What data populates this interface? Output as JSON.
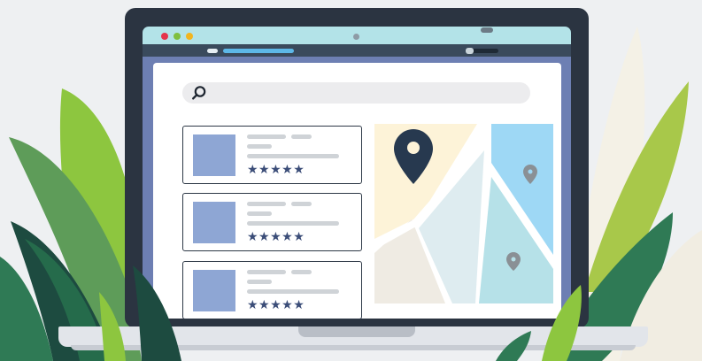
{
  "illustration": {
    "subject": "laptop showing a local search / map listing page",
    "window_dots": [
      {
        "name": "close",
        "color": "#e5344b"
      },
      {
        "name": "minimize",
        "color": "#f2b51f"
      },
      {
        "name": "maximize",
        "color": "#7fbf3f"
      }
    ],
    "colors": {
      "frame": "#2b3441",
      "browser_bar": "#b3e3e8",
      "content_bg": "#6d7fb3",
      "thumbnail": "#8ea6d4",
      "stars": "#3b4d78",
      "map_pin": "#27394f",
      "leaves": [
        "#2f7a55",
        "#8dc63f",
        "#1d4b40",
        "#a8c84a",
        "#5e9c59"
      ]
    }
  },
  "search": {
    "icon": "search-icon",
    "value": ""
  },
  "listings": [
    {
      "stars": "★★★★★",
      "rating": 5,
      "thumbnail": "image-placeholder"
    },
    {
      "stars": "★★★★★",
      "rating": 5,
      "thumbnail": "image-placeholder"
    },
    {
      "stars": "★★★★★",
      "rating": 5,
      "thumbnail": "image-placeholder"
    }
  ],
  "map": {
    "main_pin": "map-pin-icon",
    "secondary_pins": [
      "map-pin-icon",
      "map-pin-icon"
    ]
  }
}
